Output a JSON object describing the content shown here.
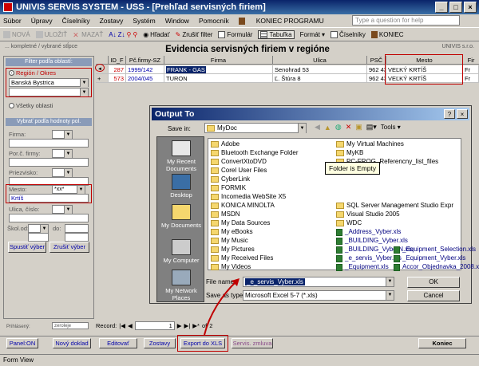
{
  "window": {
    "title": "UNIVIS SERVIS SYSTEM - USS - [Prehľad servisných firiem]",
    "controls": [
      "_",
      "□",
      "×"
    ]
  },
  "menu": {
    "items": [
      "Súbor",
      "Úpravy",
      "Číselníky",
      "Zostavy",
      "Systém",
      "Window",
      "Pomocník",
      "KONIEC PROGRAMU"
    ],
    "ask_placeholder": "Type a question for help"
  },
  "toolbar": {
    "items": [
      "NOVÁ",
      "ULOŽIŤ",
      "MAZAŤ",
      "Hľadať",
      "Zrušiť filter",
      "Formulár",
      "Tabuľka",
      "Formát",
      "Číselníky",
      "KONIEC"
    ]
  },
  "subheader": {
    "left": "... kompletné / vybrané stĺpce",
    "right": "UNIVIS s.r.o."
  },
  "form_title": "Evidencia servisných firiem v regióne",
  "left_panel": {
    "filter_area_title": "Filter podľa oblastí:",
    "region_option": "Región / Okres",
    "region_value": "Banská Bystrica",
    "all_areas_option": "Všetky oblasti",
    "filter_fields_title": "Vybrať podľa hodnoty pol.",
    "firma_label": "Firma:",
    "por_c_label": "Por.č. firmy:",
    "priezvisko_label": "Priezvisko:",
    "mesto_label": "Mesto:",
    "mesto_op": "*xx*",
    "mesto_value": "Krtíš",
    "ulica_label": "Ulica, číslo:",
    "skol_label": "Škol.od:",
    "do_label": "do:",
    "run_button": "Spustiť výber",
    "cancel_button": "Zrušiť výber",
    "footer_left": "Prihlásený:",
    "footer_right": "zeroleje"
  },
  "grid": {
    "headers": [
      "ID_F",
      "Pč.firmy-SZ",
      "Firma",
      "Ulica",
      "PSČ",
      "Mesto",
      "Fir"
    ],
    "rows": [
      {
        "marker": "◄",
        "id": "287",
        "pc": "1999/142",
        "firma": "FRANK - GAS",
        "ulica": "Senohrad  53",
        "psc": "962 43",
        "mesto": "VEĽKÝ KRTÍŠ",
        "extra": "Fr"
      },
      {
        "marker": "+",
        "id": "573",
        "pc": "2004/045",
        "firma": "TURON",
        "ulica": "Ľ. Štúra  8",
        "psc": "962 43",
        "mesto": "VEĽKÝ KRTÍŠ",
        "extra": "Fr"
      }
    ]
  },
  "dialog": {
    "title": "Output To",
    "save_in_label": "Save in:",
    "save_in_value": "MyDoc",
    "tools_label": "Tools",
    "places": [
      "My Recent Documents",
      "Desktop",
      "My Documents",
      "My Computer",
      "My Network Places"
    ],
    "files_left": [
      "Adobe",
      "Bluetooth Exchange Folder",
      "ConvertXtoDVD",
      "Corel User Files",
      "CyberLink",
      "FORMIK",
      "Incomedia WebSite X5",
      "KONICA MINOLTA",
      "MSDN",
      "My Data Sources",
      "My eBooks",
      "My Music",
      "My Pictures",
      "My Received Files",
      "My Videos"
    ],
    "files_right": [
      "My Virtual Machines",
      "MyKB",
      "PC-FROG_Referencny_list_files",
      "SQL Server Management Studio Expr",
      "Visual Studio 2005",
      "WDC"
    ],
    "xls_files": [
      "_Address_Vyber.xls",
      "_BUILDING_Vyber.xls",
      "_BUILDING_VyberN.xls",
      "_e_servis_Vyber.xls",
      "_Equipment.xls",
      "_Equipment_Selection.xls",
      "_Equipment_Vyber.xls",
      "Accor_Objednavka_2008.xls"
    ],
    "tooltip": "Folder is Empty",
    "file_name_label": "File name:",
    "file_name_value": "_e_servis_Vyber.xls",
    "save_type_label": "Save as type:",
    "save_type_value": "Microsoft Excel 5-7 (*.xls)",
    "ok_button": "OK",
    "cancel_button": "Cancel"
  },
  "record_nav": {
    "label": "Record:",
    "current": "1",
    "of_label": "of",
    "total": "2"
  },
  "bottom_buttons": [
    "Panel:ON",
    "Nový doklad",
    "Editovať",
    "Zostavy",
    "Export do XLS",
    "Servis. zmluva",
    "Koniec"
  ],
  "status_bar": "Form View",
  "colors": {
    "highlight": "#c00000",
    "title_blue": "#0a246a",
    "selection": "#0a246a"
  }
}
